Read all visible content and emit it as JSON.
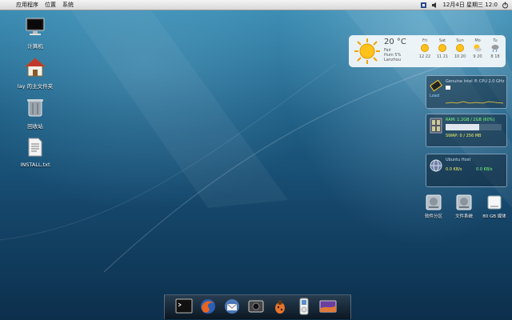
{
  "menubar": {
    "items": [
      "应用程序",
      "位置",
      "系统"
    ],
    "clock": "12月4日 星期三 12:0",
    "tray_icons": [
      "network-icon",
      "volume-icon",
      "power-icon"
    ]
  },
  "desktop_icons": [
    {
      "label": "计算机",
      "icon": "computer-icon"
    },
    {
      "label": "lay 的主文件夹",
      "icon": "home-folder-icon"
    },
    {
      "label": "回收站",
      "icon": "trash-icon"
    },
    {
      "label": "INSTALL.txt",
      "icon": "text-file-icon"
    }
  ],
  "weather": {
    "temperature": "20 °C",
    "lines": [
      "Fair",
      "Hum 5%",
      "Lanzhou"
    ],
    "forecast": [
      {
        "day": "Fri",
        "lo": "12",
        "hi": "22"
      },
      {
        "day": "Sat",
        "lo": "11",
        "hi": "21"
      },
      {
        "day": "Sun",
        "lo": "10",
        "hi": "20"
      },
      {
        "day": "Mo",
        "lo": "9",
        "hi": "20"
      },
      {
        "day": "Tu",
        "lo": "8",
        "hi": "18"
      }
    ]
  },
  "cpu_panel": {
    "title": "Genuine Intel ® CPU 2.0 GHz",
    "usage_label": "Load",
    "usage_percent": 12
  },
  "ram_panel": {
    "title": "RAM: 1.2GB / 2GB (60%)",
    "swap_label": "SWAP: 0 / 256 MB",
    "ram_percent": 60
  },
  "net_panel": {
    "title": "Ubuntu Host",
    "down": "0.0 KB/s",
    "up": "0.0 KB/s"
  },
  "drives": [
    {
      "label": "软件分区",
      "icon": "hard-drive-icon"
    },
    {
      "label": "文件系统",
      "icon": "hard-drive-icon"
    },
    {
      "label": "80 GB 媒体",
      "icon": "removable-drive-icon"
    }
  ],
  "dock": [
    "terminal-icon",
    "firefox-icon",
    "thunderbird-icon",
    "webcam-icon",
    "bug-icon",
    "ipod-icon",
    "desktop-icon"
  ]
}
